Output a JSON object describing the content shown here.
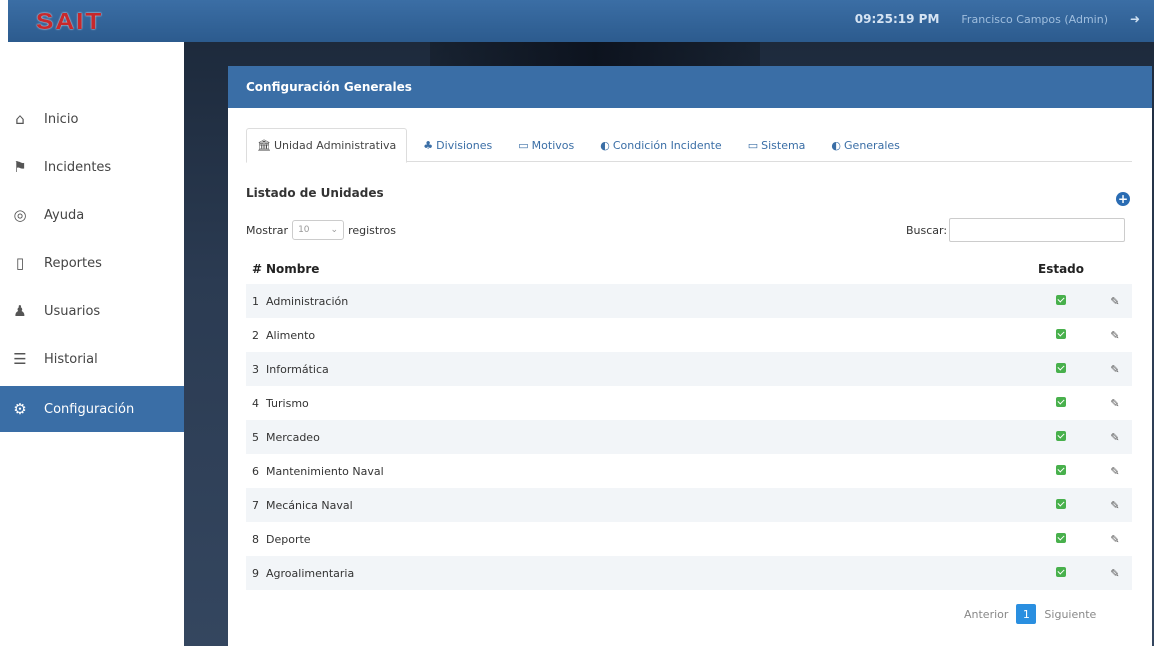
{
  "app": {
    "logo": "SAIT",
    "clock": "09:25:19 PM",
    "user": "Francisco Campos (Admin)"
  },
  "sidebar": {
    "items": [
      {
        "label": "Inicio",
        "icon": "home-icon"
      },
      {
        "label": "Incidentes",
        "icon": "incident-icon"
      },
      {
        "label": "Ayuda",
        "icon": "help-icon"
      },
      {
        "label": "Reportes",
        "icon": "report-icon"
      },
      {
        "label": "Usuarios",
        "icon": "users-icon"
      },
      {
        "label": "Historial",
        "icon": "history-icon"
      },
      {
        "label": "Configuración",
        "icon": "gear-icon",
        "active": true
      }
    ]
  },
  "panel": {
    "title": "Configuración Generales",
    "tabs": [
      {
        "label": "Unidad Administrativa",
        "icon": "building-icon",
        "active": true
      },
      {
        "label": "Divisiones",
        "icon": "sitemap-icon"
      },
      {
        "label": "Motivos",
        "icon": "folder-icon"
      },
      {
        "label": "Condición Incidente",
        "icon": "toggle-icon"
      },
      {
        "label": "Sistema",
        "icon": "laptop-icon"
      },
      {
        "label": "Generales",
        "icon": "toggle-icon"
      }
    ],
    "list_title": "Listado de Unidades",
    "length": {
      "prefix": "Mostrar",
      "value": "10",
      "suffix": "registros"
    },
    "search_label": "Buscar:",
    "columns": {
      "num": "#",
      "name": "Nombre",
      "status": "Estado"
    },
    "rows": [
      {
        "num": "1",
        "name": "Administración"
      },
      {
        "num": "2",
        "name": "Alimento"
      },
      {
        "num": "3",
        "name": "Informática"
      },
      {
        "num": "4",
        "name": "Turismo"
      },
      {
        "num": "5",
        "name": "Mercadeo"
      },
      {
        "num": "6",
        "name": "Mantenimiento Naval"
      },
      {
        "num": "7",
        "name": "Mecánica Naval"
      },
      {
        "num": "8",
        "name": "Deporte"
      },
      {
        "num": "9",
        "name": "Agroalimentaria"
      }
    ],
    "pagination": {
      "prev": "Anterior",
      "page": "1",
      "next": "Siguiente"
    }
  },
  "colors": {
    "primary": "#3a6ea6",
    "status_active": "#48b04c",
    "page_active": "#2a8fe0"
  }
}
